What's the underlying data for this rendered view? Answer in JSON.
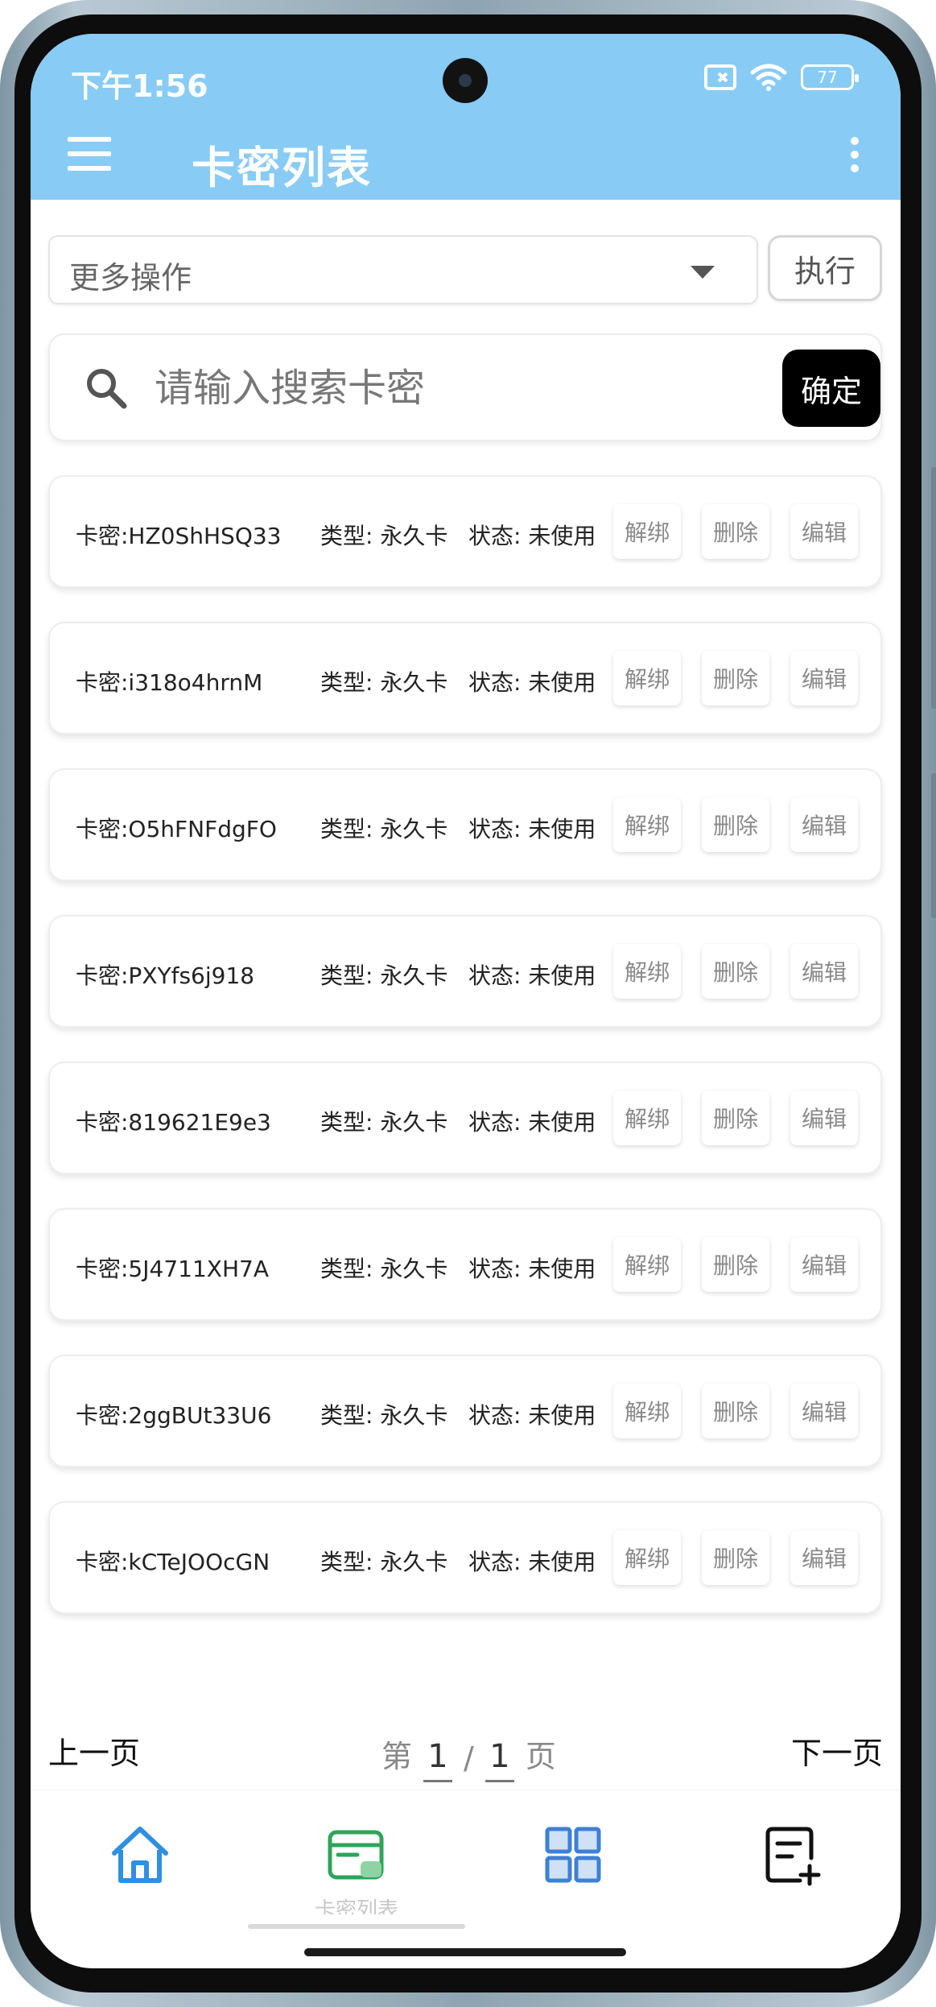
{
  "status_bar": {
    "time": "下午1:56",
    "battery": "77"
  },
  "app_bar": {
    "title": "卡密列表"
  },
  "bulk_action": {
    "select_label": "更多操作",
    "execute_label": "执行"
  },
  "search": {
    "placeholder": "请输入搜索卡密",
    "confirm_label": "确定"
  },
  "cards": [
    {
      "key": "卡密:HZ0ShHSQ33",
      "type": "类型: 永久卡",
      "status": "状态: 未使用",
      "unbind": "解绑",
      "delete": "删除",
      "edit": "编辑"
    },
    {
      "key": "卡密:i318o4hrnM",
      "type": "类型: 永久卡",
      "status": "状态: 未使用",
      "unbind": "解绑",
      "delete": "删除",
      "edit": "编辑"
    },
    {
      "key": "卡密:O5hFNFdgFO",
      "type": "类型: 永久卡",
      "status": "状态: 未使用",
      "unbind": "解绑",
      "delete": "删除",
      "edit": "编辑"
    },
    {
      "key": "卡密:PXYfs6j918",
      "type": "类型: 永久卡",
      "status": "状态: 未使用",
      "unbind": "解绑",
      "delete": "删除",
      "edit": "编辑"
    },
    {
      "key": "卡密:819621E9e3",
      "type": "类型: 永久卡",
      "status": "状态: 未使用",
      "unbind": "解绑",
      "delete": "删除",
      "edit": "编辑"
    },
    {
      "key": "卡密:5J4711XH7A",
      "type": "类型: 永久卡",
      "status": "状态: 未使用",
      "unbind": "解绑",
      "delete": "删除",
      "edit": "编辑"
    },
    {
      "key": "卡密:2ggBUt33U6",
      "type": "类型: 永久卡",
      "status": "状态: 未使用",
      "unbind": "解绑",
      "delete": "删除",
      "edit": "编辑"
    },
    {
      "key": "卡密:kCTeJOOcGN",
      "type": "类型: 永久卡",
      "status": "状态: 未使用",
      "unbind": "解绑",
      "delete": "删除",
      "edit": "编辑"
    }
  ],
  "pagination": {
    "prev_label": "上一页",
    "next_label": "下一页",
    "prefix": "第",
    "current": "1",
    "separator": "/",
    "total": "1",
    "suffix": "页"
  },
  "bottom_nav": {
    "items": [
      {
        "icon": "home-icon"
      },
      {
        "icon": "card-list-icon",
        "label": "卡密列表",
        "active": true
      },
      {
        "icon": "grid-icon"
      },
      {
        "icon": "add-note-icon"
      }
    ]
  },
  "colors": {
    "app_bar": "#88cbf5",
    "home_icon": "#2f8fe0",
    "card_icon": "#2fa45a",
    "grid_icon": "#3d80d6"
  }
}
